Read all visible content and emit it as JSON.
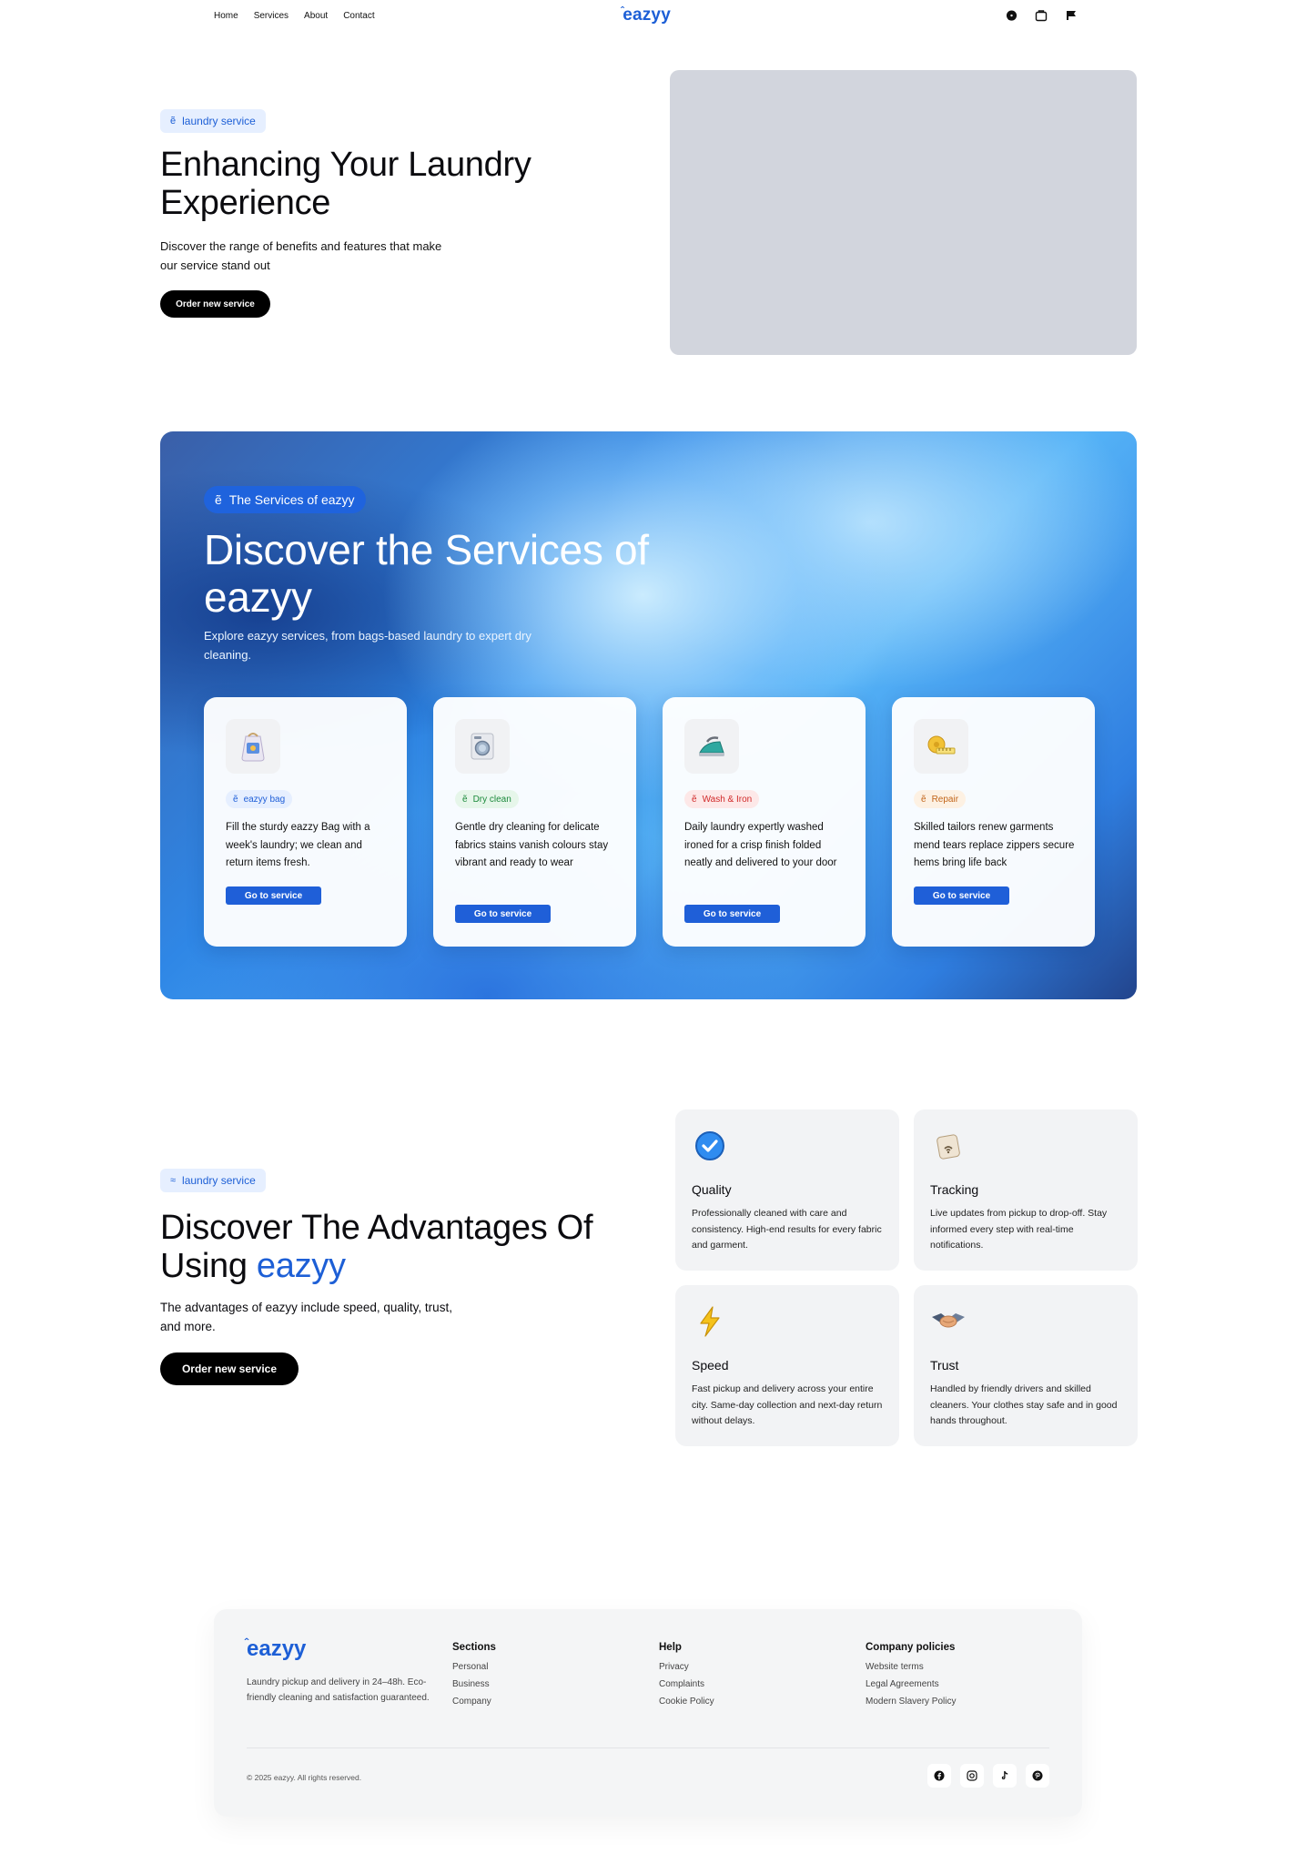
{
  "nav": {
    "links": [
      "Home",
      "Services",
      "About",
      "Contact"
    ],
    "brand": "eazyy",
    "icons": [
      "chat-icon",
      "bag-icon",
      "flag-icon"
    ]
  },
  "hero": {
    "pill_label": "laundry service",
    "title": "Enhancing Your Laundry Experience",
    "description": "Discover the range of benefits and features that make our service stand out",
    "button_label": "Order new service"
  },
  "services": {
    "pill_label": "The Services of eazyy",
    "title": "Discover the Services of eazyy",
    "description": "Explore eazyy services, from bags-based laundry to expert dry cleaning.",
    "cards": [
      {
        "tag": "eazyy bag",
        "text": "Fill the sturdy eazzy Bag with a week's laundry; we clean and return items fresh.",
        "button": "Go to service",
        "icon": "laundry-bag-icon",
        "tag_color": "#1f5fd8",
        "tag_bg": "#e6efff"
      },
      {
        "tag": "Dry clean",
        "text": "Gentle dry cleaning for delicate fabrics stains vanish colours stay vibrant and ready to wear",
        "button": "Go to service",
        "icon": "washing-machine-icon",
        "tag_color": "#1c8a3c",
        "tag_bg": "#e6f6ea"
      },
      {
        "tag": "Wash & Iron",
        "text": "Daily laundry expertly washed ironed for a crisp finish folded neatly and delivered to your door",
        "button": "Go to service",
        "icon": "iron-icon",
        "tag_color": "#d12a2a",
        "tag_bg": "#fde8e8"
      },
      {
        "tag": "Repair",
        "text": "Skilled tailors renew garments mend tears replace zippers secure hems bring life back",
        "button": "Go to service",
        "icon": "tape-measure-icon",
        "tag_color": "#c2651a",
        "tag_bg": "#fdf1e3"
      }
    ]
  },
  "advantages": {
    "pill_label": "laundry service",
    "title_main": "Discover The Advantages Of Using",
    "title_brand": "eazyy",
    "description": "The advantages of eazyy include speed, quality, trust, and more.",
    "button_label": "Order new service",
    "features": [
      {
        "name": "Quality",
        "text": "Professionally cleaned with care and consistency. High-end results for every fabric and garment.",
        "icon": "check-badge-icon"
      },
      {
        "name": "Tracking",
        "text": "Live updates from pickup to drop-off. Stay informed every step with real-time notifications.",
        "icon": "tracking-tag-icon"
      },
      {
        "name": "Speed",
        "text": "Fast pickup and delivery across your entire city. Same-day collection and next-day return without delays.",
        "icon": "lightning-icon"
      },
      {
        "name": "Trust",
        "text": "Handled by friendly drivers and skilled cleaners. Your clothes stay safe and in good hands throughout.",
        "icon": "handshake-icon"
      }
    ]
  },
  "footer": {
    "brand": "eazyy",
    "tagline": "Laundry pickup and delivery in 24–48h. Eco-friendly cleaning and satisfaction guaranteed.",
    "columns": [
      {
        "title": "Sections",
        "items": [
          "Personal",
          "Business",
          "Company"
        ]
      },
      {
        "title": "Help",
        "items": [
          "Privacy",
          "Complaints",
          "Cookie Policy"
        ]
      },
      {
        "title": "Company policies",
        "items": [
          "Website terms",
          "Legal Agreements",
          "Modern Slavery Policy"
        ]
      }
    ],
    "copyright": "© 2025 eazyy. All rights reserved.",
    "social": [
      "facebook-icon",
      "instagram-icon",
      "tiktok-icon",
      "pinterest-icon"
    ]
  }
}
